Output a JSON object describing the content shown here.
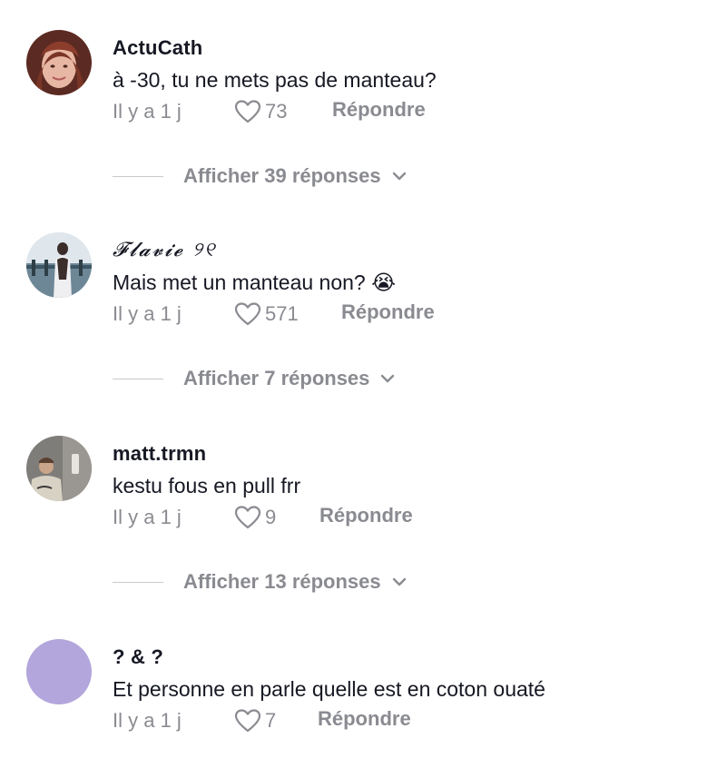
{
  "comments": [
    {
      "username": "ActuCath",
      "text": "à -30, tu ne mets pas de manteau?",
      "time": "Il y a 1 j",
      "likes": "73",
      "reply_label": "Répondre",
      "view_replies": "Afficher 39 réponses",
      "avatar_color": "#c58a78"
    },
    {
      "username": "𝓕𝓵𝓪𝓿𝓲𝓮 ୨୧",
      "text": "Mais met un manteau non? 😭",
      "time": "Il y a 1 j",
      "likes": "571",
      "reply_label": "Répondre",
      "view_replies": "Afficher 7 réponses",
      "avatar_color": "#7f98a8"
    },
    {
      "username": "matt.trmn",
      "text": "kestu fous en pull frr",
      "time": "Il y a 1 j",
      "likes": "9",
      "reply_label": "Répondre",
      "view_replies": "Afficher 13 réponses",
      "avatar_color": "#8c8a86"
    },
    {
      "username": "? & ?",
      "text": "Et personne en parle quelle est en coton ouaté",
      "time": "Il y a 1 j",
      "likes": "7",
      "reply_label": "Répondre",
      "avatar_color": "#b3a6dc"
    }
  ],
  "icons": {
    "like": "heart-outline-icon",
    "expand": "chevron-down-icon"
  },
  "colors": {
    "secondary_text": "#8a8b91",
    "primary_text": "#161823"
  }
}
